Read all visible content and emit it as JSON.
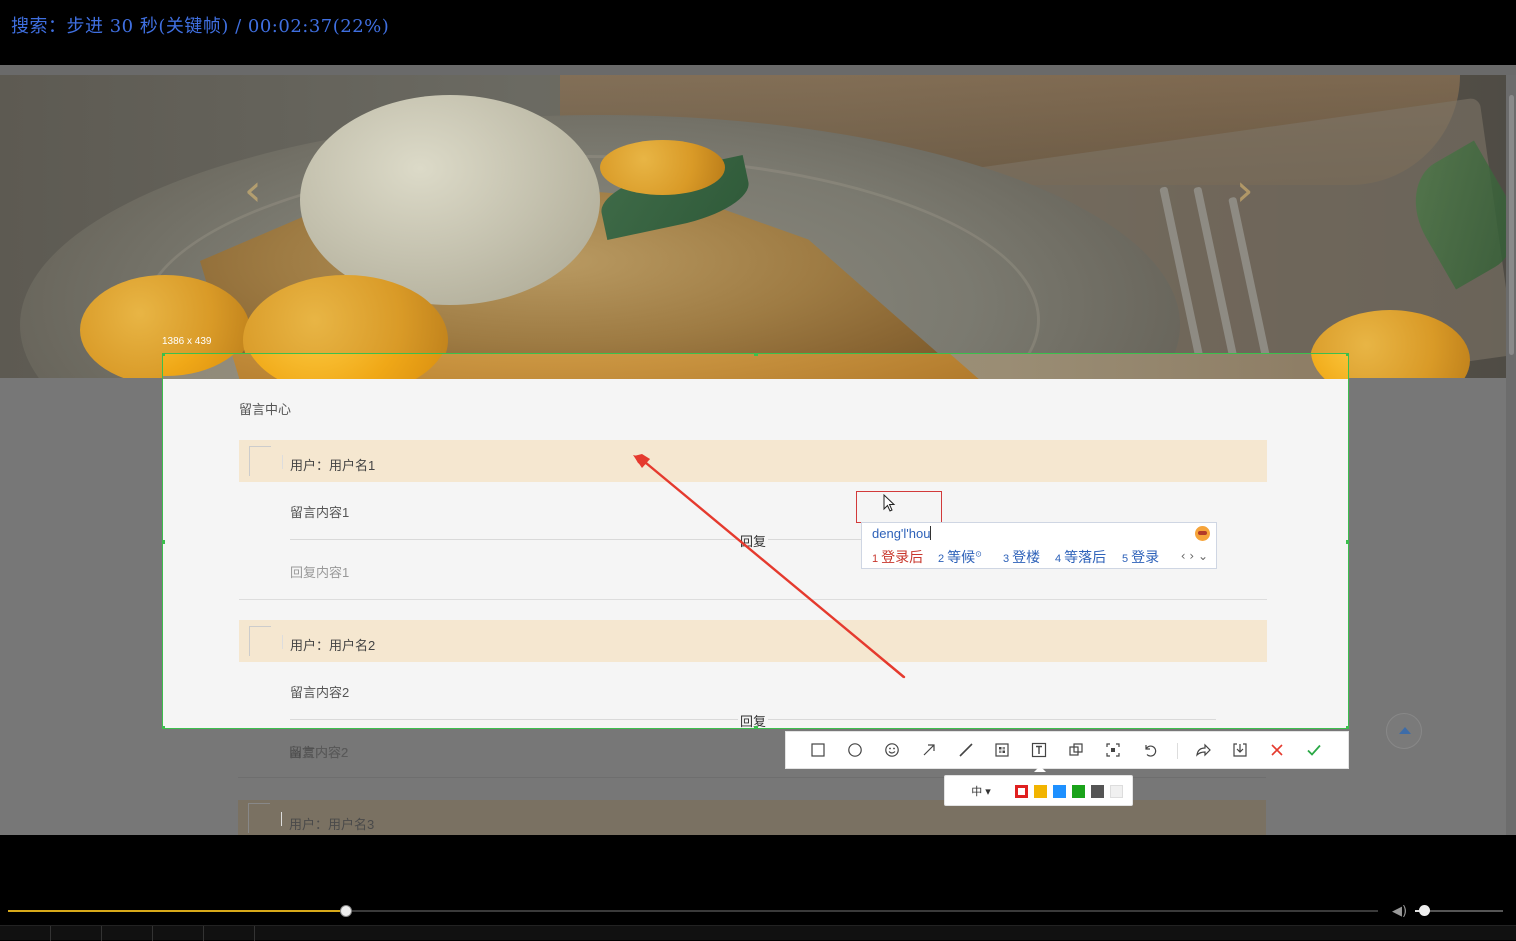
{
  "osd": {
    "text": "搜索：步进 30 秒(关键帧) / 00:02:37(22%)"
  },
  "selection": {
    "dimensions_label": "1386 x 439"
  },
  "message_center": {
    "title": "留言中心",
    "reply_label": "回复",
    "messages": [
      {
        "user": "用户：用户名1",
        "content": "留言内容1",
        "reply": "回复内容1"
      },
      {
        "user": "用户：用户名2",
        "content": "留言内容2",
        "reply": "回复内容2"
      },
      {
        "user": "用户：用户名3"
      }
    ]
  },
  "ime": {
    "input": "deng'l'hou",
    "candidates": [
      {
        "num": "1",
        "text": "登录后"
      },
      {
        "num": "2",
        "text": "等候"
      },
      {
        "num": "3",
        "text": "登楼"
      },
      {
        "num": "4",
        "text": "等落后"
      },
      {
        "num": "5",
        "text": "登录"
      }
    ]
  },
  "toolbar": {
    "tools": [
      "rectangle-icon",
      "ellipse-icon",
      "emoji-icon",
      "arrow-icon",
      "line-icon",
      "mosaic-icon",
      "text-icon",
      "copy-icon",
      "ocr-icon",
      "undo-icon",
      "share-icon",
      "download-icon",
      "cancel-icon",
      "confirm-icon"
    ],
    "font_size_label": "中",
    "colors": [
      "#e02020",
      "#f2b400",
      "#1e90ff",
      "#1aa31a",
      "#555555",
      "#f0f0f0"
    ],
    "selected_color": "#e02020"
  },
  "player": {
    "progress": 0.22,
    "volume": 0.1
  }
}
